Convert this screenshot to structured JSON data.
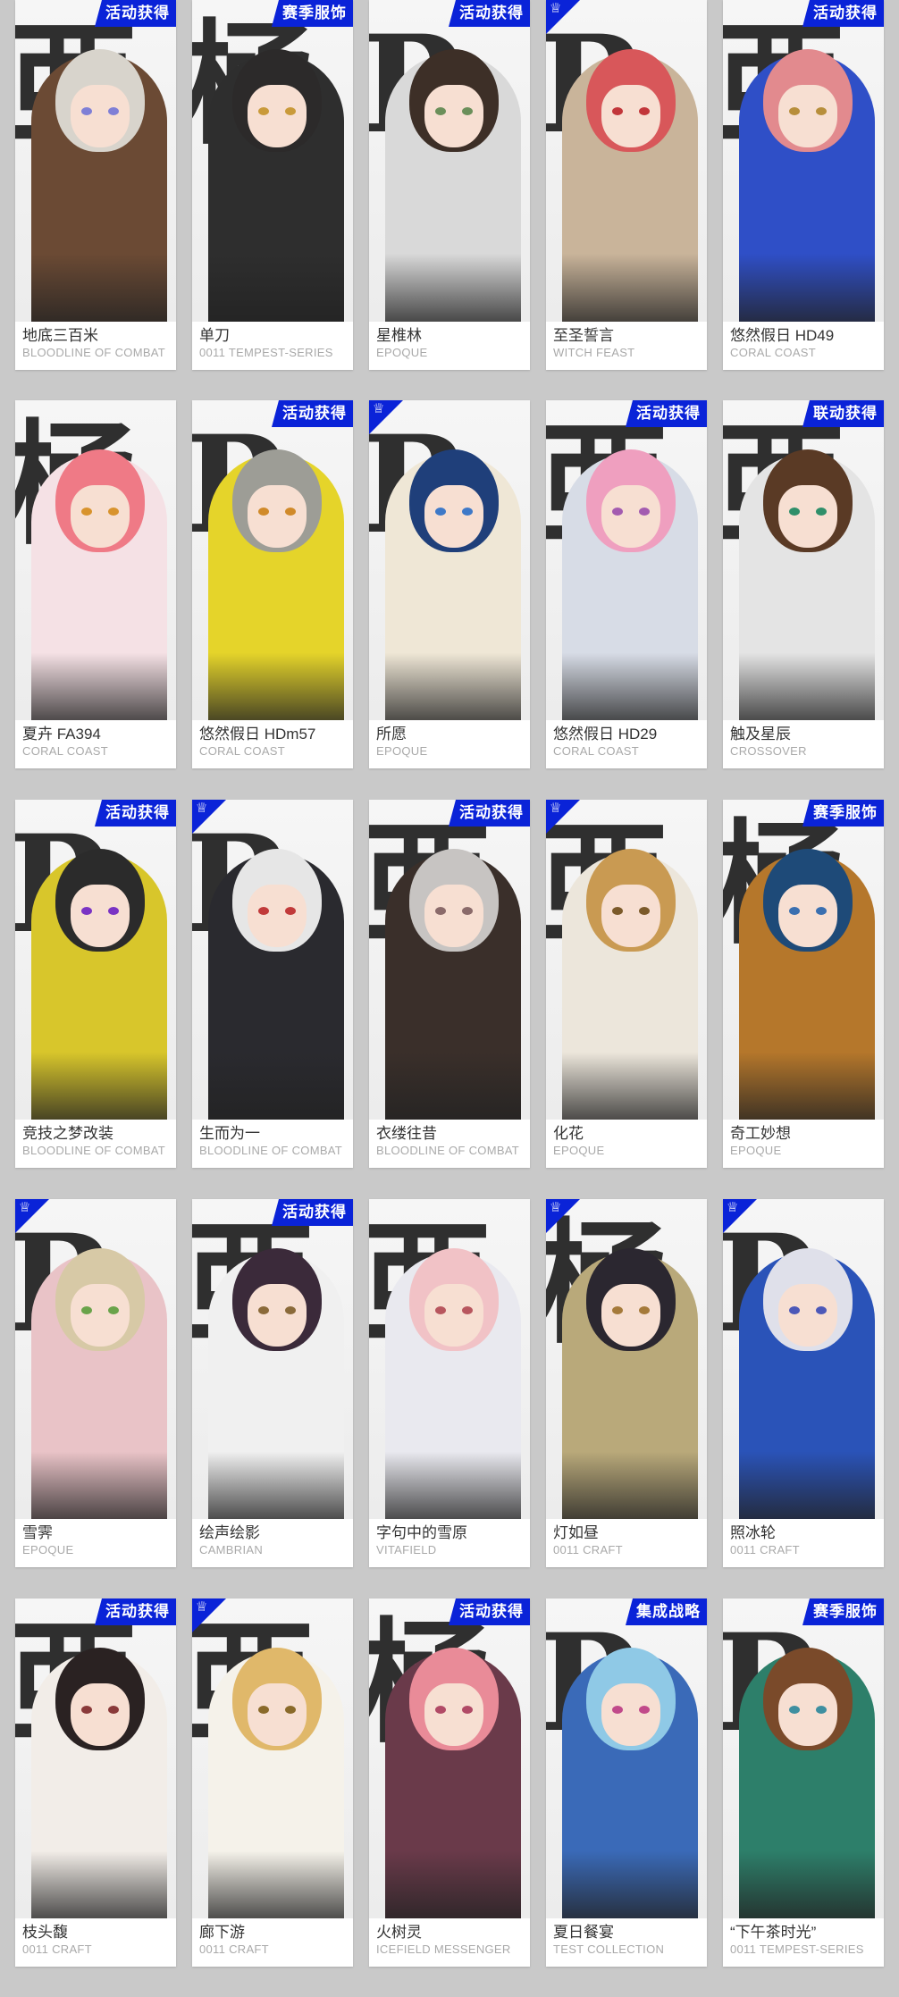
{
  "skins": [
    {
      "name": "地底三百米",
      "series": "BLOODLINE OF COMBAT",
      "badge": "活动获得",
      "corner": false,
      "palette": {
        "hair": "#d8d4cc",
        "outfit": "#6b4a34",
        "eye": "#7f7fd6"
      }
    },
    {
      "name": "单刀",
      "series": "0011 TEMPEST-SERIES",
      "badge": "赛季服饰",
      "corner": false,
      "palette": {
        "hair": "#2c2a2a",
        "outfit": "#2e2e2e",
        "eye": "#c99a3a"
      }
    },
    {
      "name": "星椎林",
      "series": "EPOQUE",
      "badge": "活动获得",
      "corner": false,
      "palette": {
        "hair": "#3d2f27",
        "outfit": "#d9d9d9",
        "eye": "#6b8f5a"
      }
    },
    {
      "name": "至圣誓言",
      "series": "WITCH FEAST",
      "badge": "",
      "corner": true,
      "palette": {
        "hair": "#d8575a",
        "outfit": "#c9b49a",
        "eye": "#c2363a"
      }
    },
    {
      "name": "悠然假日 HD49",
      "series": "CORAL COAST",
      "badge": "活动获得",
      "corner": false,
      "palette": {
        "hair": "#e28a8e",
        "outfit": "#2f4fc7",
        "eye": "#b78e3b"
      }
    },
    {
      "name": "夏卉 FA394",
      "series": "CORAL COAST",
      "badge": "",
      "corner": false,
      "palette": {
        "hair": "#ef7a86",
        "outfit": "#f5e1e5",
        "eye": "#d8932d"
      }
    },
    {
      "name": "悠然假日 HDm57",
      "series": "CORAL COAST",
      "badge": "活动获得",
      "corner": false,
      "palette": {
        "hair": "#9d9d96",
        "outfit": "#e5d42a",
        "eye": "#d08a2a"
      }
    },
    {
      "name": "所愿",
      "series": "EPOQUE",
      "badge": "",
      "corner": true,
      "palette": {
        "hair": "#1f3f7a",
        "outfit": "#efe7d6",
        "eye": "#3e79c8"
      }
    },
    {
      "name": "悠然假日 HD29",
      "series": "CORAL COAST",
      "badge": "活动获得",
      "corner": false,
      "palette": {
        "hair": "#ef9fbf",
        "outfit": "#d7dce6",
        "eye": "#a35bb0"
      }
    },
    {
      "name": "触及星辰",
      "series": "CROSSOVER",
      "badge": "联动获得",
      "corner": false,
      "palette": {
        "hair": "#5a3a25",
        "outfit": "#e4e4e4",
        "eye": "#2f8f6a"
      }
    },
    {
      "name": "竞技之梦改装",
      "series": "BLOODLINE OF COMBAT",
      "badge": "活动获得",
      "corner": false,
      "palette": {
        "hair": "#2b2b2b",
        "outfit": "#d8c62b",
        "eye": "#7a33c4"
      }
    },
    {
      "name": "生而为一",
      "series": "BLOODLINE OF COMBAT",
      "badge": "",
      "corner": true,
      "palette": {
        "hair": "#e6e6e6",
        "outfit": "#2a2a2f",
        "eye": "#c13a3a"
      }
    },
    {
      "name": "衣缕往昔",
      "series": "BLOODLINE OF COMBAT",
      "badge": "活动获得",
      "corner": false,
      "palette": {
        "hair": "#c7c4c2",
        "outfit": "#3a2f2a",
        "eye": "#8a6a6a"
      }
    },
    {
      "name": "化花",
      "series": "EPOQUE",
      "badge": "",
      "corner": true,
      "palette": {
        "hair": "#c99a52",
        "outfit": "#ece6db",
        "eye": "#7b5a2a"
      }
    },
    {
      "name": "奇工妙想",
      "series": "EPOQUE",
      "badge": "赛季服饰",
      "corner": false,
      "palette": {
        "hair": "#1e4a78",
        "outfit": "#b5772b",
        "eye": "#3a6fb0"
      }
    },
    {
      "name": "雪霁",
      "series": "EPOQUE",
      "badge": "",
      "corner": true,
      "palette": {
        "hair": "#d7c9a6",
        "outfit": "#e9c3c7",
        "eye": "#6aa34a"
      }
    },
    {
      "name": "绘声绘影",
      "series": "CAMBRIAN",
      "badge": "活动获得",
      "corner": false,
      "palette": {
        "hair": "#3b2a3a",
        "outfit": "#f0f0f0",
        "eye": "#8a6a3a"
      }
    },
    {
      "name": "字句中的雪原",
      "series": "VITAFIELD",
      "badge": "",
      "corner": false,
      "palette": {
        "hair": "#f1c2c6",
        "outfit": "#e9e9ef",
        "eye": "#b8565e"
      }
    },
    {
      "name": "灯如昼",
      "series": "0011 CRAFT",
      "badge": "",
      "corner": true,
      "palette": {
        "hair": "#2b2730",
        "outfit": "#b9a97a",
        "eye": "#a57a3a"
      }
    },
    {
      "name": "照冰轮",
      "series": "0011 CRAFT",
      "badge": "",
      "corner": true,
      "palette": {
        "hair": "#dfe0ea",
        "outfit": "#2a53b8",
        "eye": "#4c58b8"
      }
    },
    {
      "name": "枝头馥",
      "series": "0011 CRAFT",
      "badge": "活动获得",
      "corner": false,
      "palette": {
        "hair": "#2a2222",
        "outfit": "#f2ede8",
        "eye": "#8a3a3a"
      }
    },
    {
      "name": "廊下游",
      "series": "0011 CRAFT",
      "badge": "",
      "corner": true,
      "palette": {
        "hair": "#e0b86a",
        "outfit": "#f5f2ea",
        "eye": "#8a6a2a"
      }
    },
    {
      "name": "火树灵",
      "series": "ICEFIELD MESSENGER",
      "badge": "活动获得",
      "corner": false,
      "palette": {
        "hair": "#e98b98",
        "outfit": "#6a3a4a",
        "eye": "#b14a66"
      }
    },
    {
      "name": "夏日餐宴",
      "series": "TEST COLLECTION",
      "badge": "集成战略",
      "corner": false,
      "palette": {
        "hair": "#8fc9e6",
        "outfit": "#3a6ab8",
        "eye": "#c14a8a"
      }
    },
    {
      "name": "“下午茶时光”",
      "series": "0011 TEMPEST-SERIES",
      "badge": "赛季服饰",
      "corner": false,
      "palette": {
        "hair": "#7a4a2a",
        "outfit": "#2d7f6a",
        "eye": "#3f8fa0"
      }
    }
  ],
  "colors": {
    "badge_bg": "#0a23d8",
    "badge_text": "#ffffff",
    "page_bg": "#c9c9c9",
    "card_bg": "#ffffff",
    "series_text": "#a9a9a9"
  },
  "icons": {
    "corner_mark": "operator-emblem-icon"
  }
}
